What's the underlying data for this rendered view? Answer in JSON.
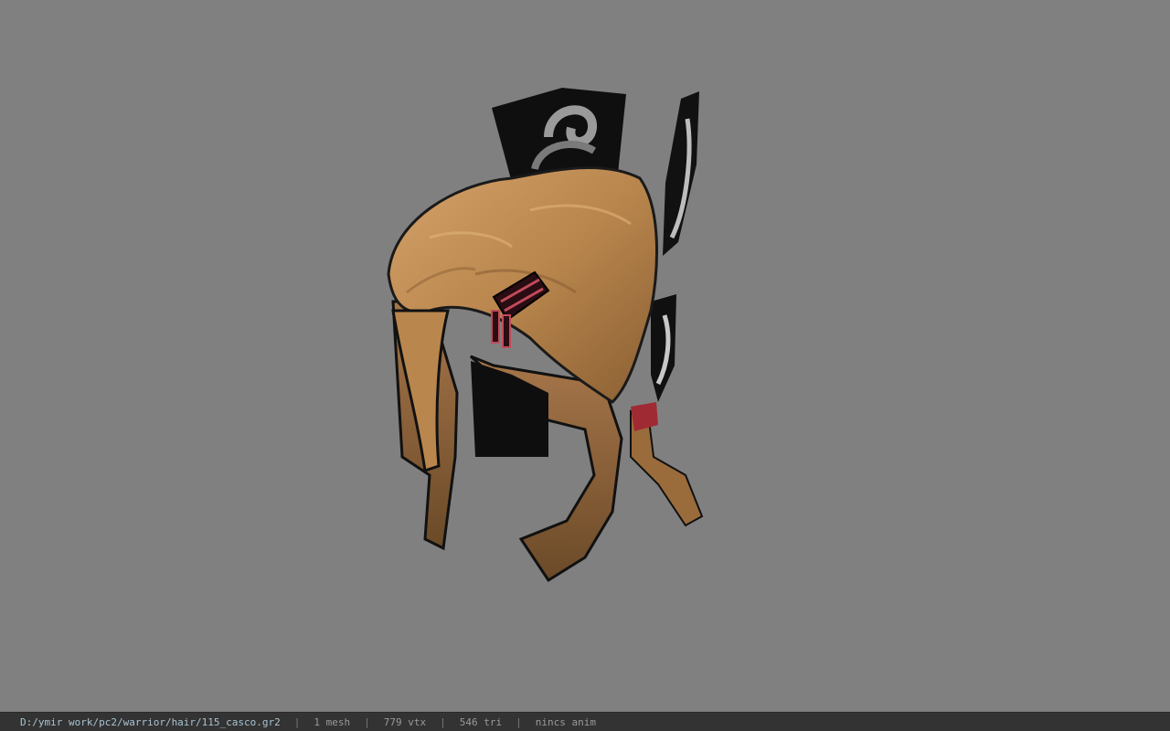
{
  "viewer": {
    "background_color": "#808080"
  },
  "model": {
    "hair_color": "#b9864d",
    "icon": "hair-helmet-model"
  },
  "statusbar": {
    "file_path": "D:/ymir work/pc2/warrior/hair/115_casco.gr2",
    "separator": "|",
    "mesh_count": "1 mesh",
    "vertex_count": "779 vtx",
    "triangle_count": "546 tri",
    "animation": "nincs anim"
  }
}
